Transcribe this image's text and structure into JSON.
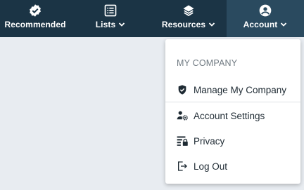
{
  "nav": {
    "items": [
      {
        "label": "Recommended",
        "icon": "verified-badge-icon",
        "has_dropdown": false
      },
      {
        "label": "Lists",
        "icon": "list-icon",
        "has_dropdown": true
      },
      {
        "label": "Resources",
        "icon": "layers-icon",
        "has_dropdown": true
      },
      {
        "label": "Account",
        "icon": "account-circle-icon",
        "has_dropdown": true,
        "active": true
      }
    ]
  },
  "account_menu": {
    "section_header": "MY COMPANY",
    "items": [
      {
        "label": "Manage My Company",
        "icon": "shield-check-icon"
      },
      {
        "label": "Account Settings",
        "icon": "user-settings-icon"
      },
      {
        "label": "Privacy",
        "icon": "privacy-lock-icon"
      },
      {
        "label": "Log Out",
        "icon": "logout-icon"
      }
    ]
  },
  "colors": {
    "navbar_bg": "#1b3445",
    "navbar_active_bg": "#2a4a5f",
    "page_bg": "#e8ecf1",
    "menu_text": "#1e2a33",
    "section_header_text": "#707a82"
  }
}
